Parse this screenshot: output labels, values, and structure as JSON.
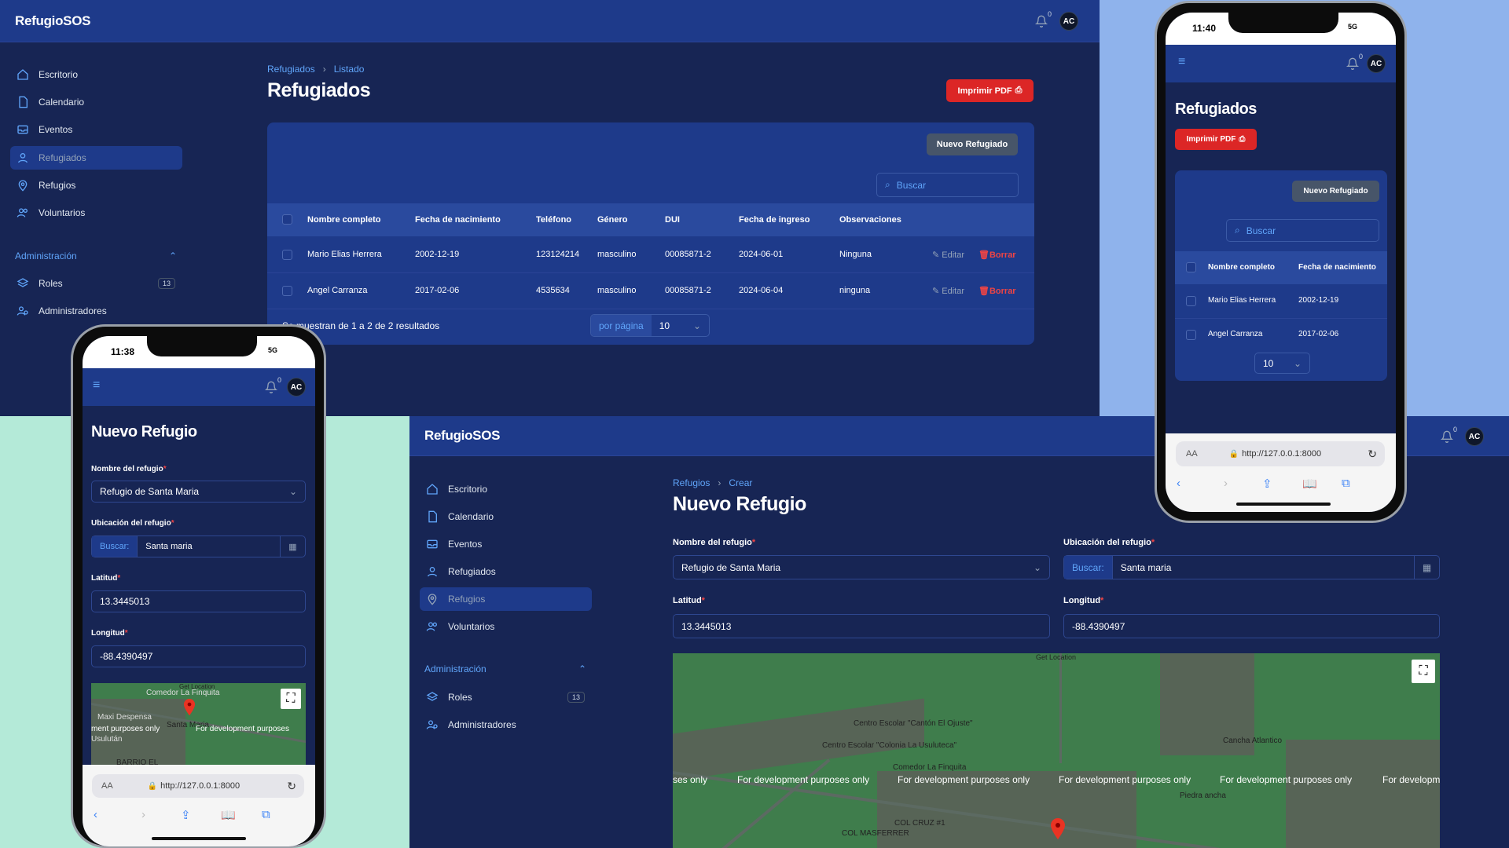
{
  "app": {
    "name": "RefugioSOS",
    "notifications": "0",
    "user_initials": "AC"
  },
  "sidebar": {
    "items": [
      {
        "label": "Escritorio"
      },
      {
        "label": "Calendario"
      },
      {
        "label": "Eventos"
      },
      {
        "label": "Refugiados"
      },
      {
        "label": "Refugios"
      },
      {
        "label": "Voluntarios"
      }
    ],
    "section": "Administración",
    "admin_items": [
      {
        "label": "Roles",
        "count": "13"
      },
      {
        "label": "Administradores"
      }
    ]
  },
  "refugiados": {
    "breadcrumb": [
      "Refugiados",
      "Listado"
    ],
    "title": "Refugiados",
    "print_label": "Imprimir PDF",
    "new_label": "Nuevo Refugiado",
    "search_placeholder": "Buscar",
    "columns": [
      "Nombre completo",
      "Fecha de nacimiento",
      "Teléfono",
      "Género",
      "DUI",
      "Fecha de ingreso",
      "Observaciones"
    ],
    "rows": [
      [
        "Mario Elias Herrera",
        "2002-12-19",
        "123124214",
        "masculino",
        "00085871-2",
        "2024-06-01",
        "Ninguna"
      ],
      [
        "Angel Carranza",
        "2017-02-06",
        "4535634",
        "masculino",
        "00085871-2",
        "2024-06-04",
        "ninguna"
      ]
    ],
    "edit_label": "Editar",
    "delete_label": "Borrar",
    "results_text": "Se muestran de 1 a 2 de 2 resultados",
    "per_page_label": "por página",
    "per_page_value": "10"
  },
  "refugio": {
    "breadcrumb": [
      "Refugios",
      "Crear"
    ],
    "title": "Nuevo Refugio",
    "name_label": "Nombre del refugio",
    "name_value": "Refugio de Santa Maria",
    "loc_label": "Ubicación del refugio",
    "loc_prefix": "Buscar:",
    "loc_value": "Santa maria",
    "lat_label": "Latitud",
    "lat_value": "13.3445013",
    "lng_label": "Longitud",
    "lng_value": "-88.4390497"
  },
  "map": {
    "get_location": "Get Location",
    "watermark": "For development purposes only",
    "places": [
      "Centro Escolar \"Cantón El Ojuste\"",
      "Centro Escolar \"Colonia La Usuluteca\"",
      "Comedor La Finquita",
      "Cancha Atlantico",
      "Piedra ancha",
      "COL CRUZ #1",
      "COL MASFERRER"
    ],
    "phone_places": [
      "Comedor La Finquita",
      "Maxi Despensa",
      "Santa Maria",
      "Usulután",
      "BARRIO EL"
    ],
    "phone_watermark_a": "ment purposes only",
    "phone_watermark_b": "For development purposes",
    "partial_watermark_l": "ses only",
    "partial_watermark_r": "For developm"
  },
  "phones": {
    "left_time": "11:38",
    "right_time": "11:40",
    "network": "5G",
    "url": "http://127.0.0.1:8000",
    "aa": "AA"
  }
}
